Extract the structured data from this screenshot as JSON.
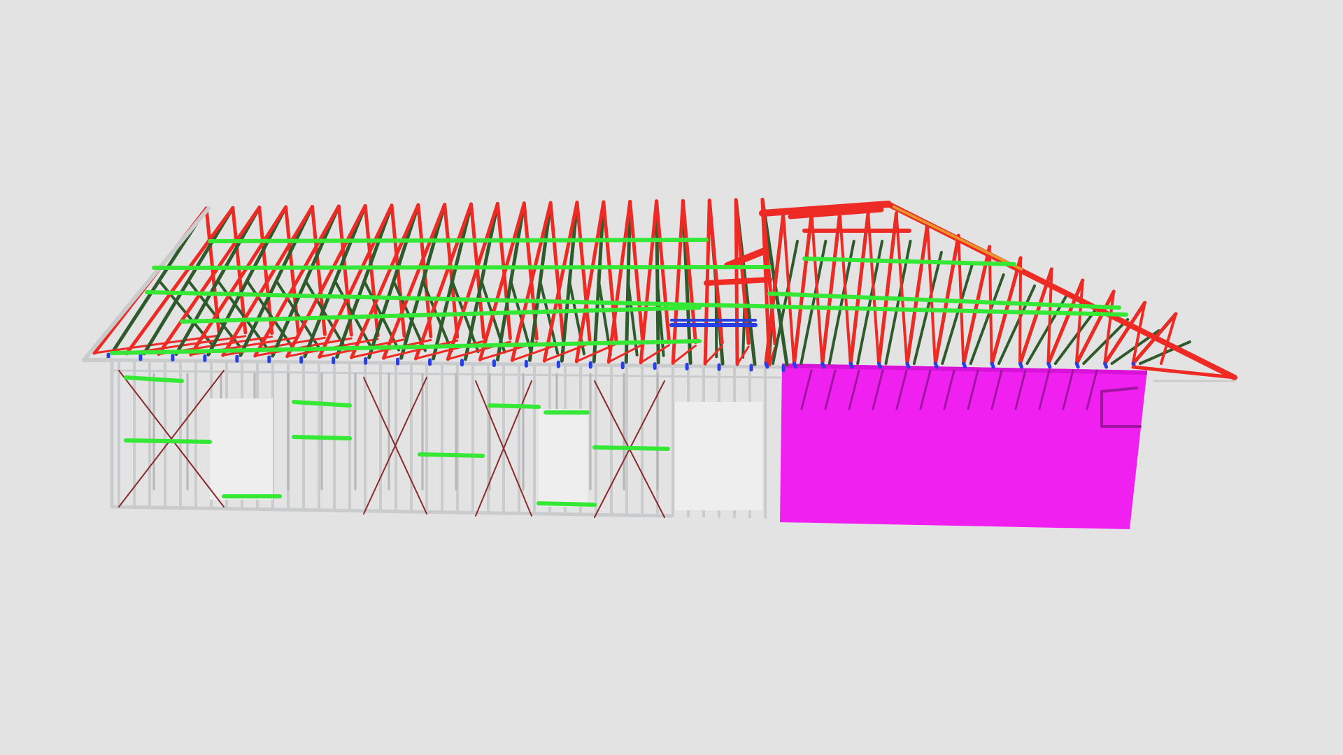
{
  "viewer": {
    "background": "#e3e3e3"
  },
  "model": {
    "name_icon": "building-frame-model",
    "colors": {
      "truss": "#ee2a24",
      "truss_web": "#2f5a2c",
      "batten": "#35e835",
      "stud": "#c9cbcd",
      "brace": "#8a2a2a",
      "tie": "#2a3fe0",
      "garage_wall": "#f020f0",
      "hip_ridge": "#e8962a"
    },
    "truss_count_main": 22,
    "truss_count_hip": 14
  }
}
